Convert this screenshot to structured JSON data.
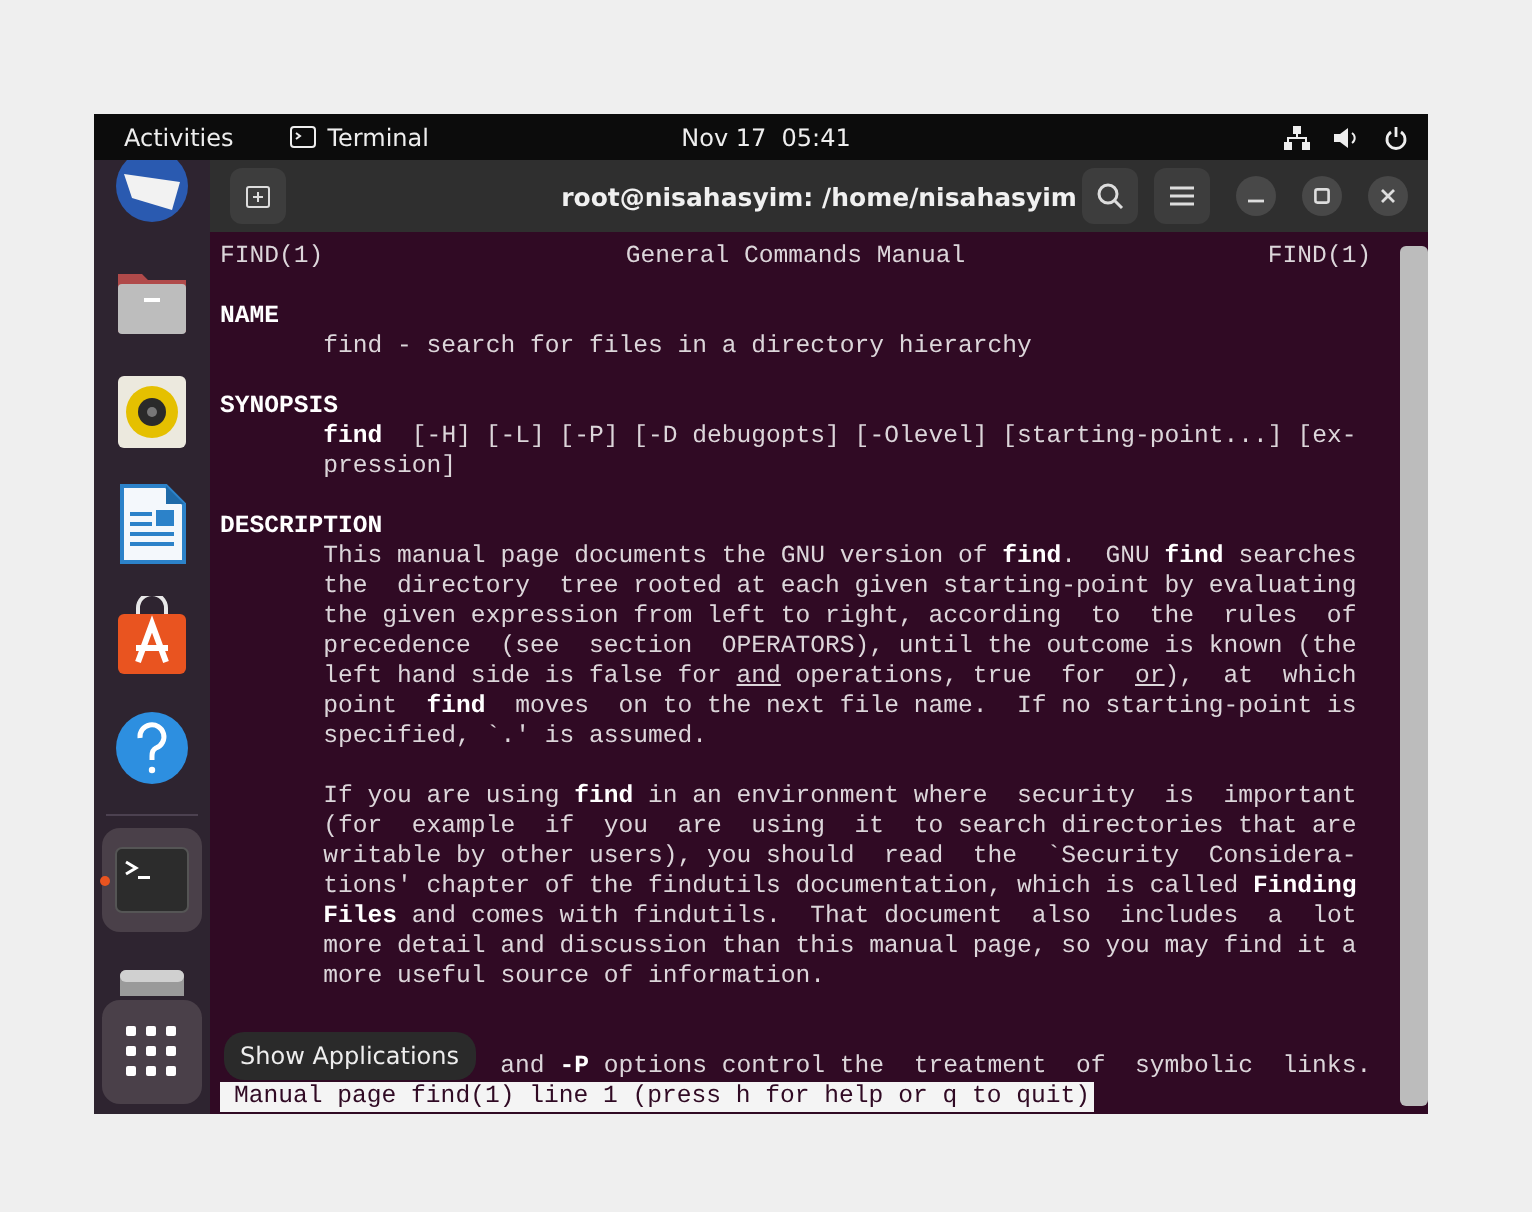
{
  "top_bar": {
    "activities": "Activities",
    "app_name": "Terminal",
    "clock": "Nov 17  05:41"
  },
  "dock": {
    "items": [
      {
        "kind": "mail",
        "selected": false,
        "running": false
      },
      {
        "kind": "files",
        "selected": false,
        "running": false
      },
      {
        "kind": "music",
        "selected": false,
        "running": false
      },
      {
        "kind": "writer",
        "selected": false,
        "running": false
      },
      {
        "kind": "store",
        "selected": false,
        "running": false
      },
      {
        "kind": "help",
        "selected": false,
        "running": false
      },
      {
        "kind": "separator"
      },
      {
        "kind": "terminal",
        "selected": true,
        "running": true
      },
      {
        "kind": "drive",
        "selected": false,
        "running": false
      }
    ],
    "show_apps": {
      "tooltip": "Show Applications",
      "hovered": true
    }
  },
  "window": {
    "title": "root@nisahasyim: /home/nisahasyim"
  },
  "man": {
    "header": {
      "left": "FIND(1)",
      "center": "General Commands Manual",
      "right": "FIND(1)"
    },
    "lines": [
      {
        "kind": "blank"
      },
      {
        "kind": "heading",
        "segments": [
          {
            "text": "NAME"
          }
        ]
      },
      {
        "kind": "body",
        "segments": [
          {
            "text": "find - search for files in a directory hierarchy"
          }
        ]
      },
      {
        "kind": "blank"
      },
      {
        "kind": "heading",
        "segments": [
          {
            "text": "SYNOPSIS"
          }
        ]
      },
      {
        "kind": "body",
        "segments": [
          {
            "text": "find",
            "kind": "bold"
          },
          {
            "text": "  [-H] [-L] [-P] [-D debugopts] [-Olevel] [starting-point...] [ex-"
          }
        ]
      },
      {
        "kind": "body",
        "segments": [
          {
            "text": "pression]"
          }
        ]
      },
      {
        "kind": "blank"
      },
      {
        "kind": "heading",
        "segments": [
          {
            "text": "DESCRIPTION"
          }
        ]
      },
      {
        "kind": "body",
        "segments": [
          {
            "text": "This manual page documents the GNU version of "
          },
          {
            "text": "find",
            "kind": "bold"
          },
          {
            "text": ".  GNU "
          },
          {
            "text": "find",
            "kind": "bold"
          },
          {
            "text": " searches"
          }
        ]
      },
      {
        "kind": "body",
        "segments": [
          {
            "text": "the  directory  tree rooted at each given starting-point by evaluating"
          }
        ]
      },
      {
        "kind": "body",
        "segments": [
          {
            "text": "the given expression from left to right, according  to  the  rules  of"
          }
        ]
      },
      {
        "kind": "body",
        "segments": [
          {
            "text": "precedence  (see  section  OPERATORS), until the outcome is known (the"
          }
        ]
      },
      {
        "kind": "body",
        "segments": [
          {
            "text": "left hand side is false for "
          },
          {
            "text": "and",
            "kind": "underlined"
          },
          {
            "text": " operations, true  for  "
          },
          {
            "text": "or",
            "kind": "underlined"
          },
          {
            "text": "),  at  which"
          }
        ]
      },
      {
        "kind": "body",
        "segments": [
          {
            "text": "point  "
          },
          {
            "text": "find",
            "kind": "bold"
          },
          {
            "text": "  moves  on to the next file name.  If no starting-point is"
          }
        ]
      },
      {
        "kind": "body",
        "segments": [
          {
            "text": "specified, `.' is assumed."
          }
        ]
      },
      {
        "kind": "blank"
      },
      {
        "kind": "body",
        "segments": [
          {
            "text": "If you are using "
          },
          {
            "text": "find",
            "kind": "bold"
          },
          {
            "text": " in an environment where  security  is  important"
          }
        ]
      },
      {
        "kind": "body",
        "segments": [
          {
            "text": "(for  example  if  you  are  using  it  to search directories that are"
          }
        ]
      },
      {
        "kind": "body",
        "segments": [
          {
            "text": "writable by other users), you should  read  the  `Security  Considera-"
          }
        ]
      },
      {
        "kind": "body",
        "segments": [
          {
            "text": "tions' chapter of the findutils documentation, which is called "
          },
          {
            "text": "Finding",
            "kind": "bold"
          }
        ]
      },
      {
        "kind": "body",
        "segments": [
          {
            "text": "Files",
            "kind": "bold"
          },
          {
            "text": " and comes with findutils.  That document  also  includes  a  lot"
          }
        ]
      },
      {
        "kind": "body",
        "segments": [
          {
            "text": "more detail and discussion than this manual page, so you may find it a"
          }
        ]
      },
      {
        "kind": "body",
        "segments": [
          {
            "text": "more useful source of information."
          }
        ]
      },
      {
        "kind": "blank"
      },
      {
        "kind": "blank"
      },
      {
        "kind": "covered",
        "segments": [
          {
            "text": "and "
          },
          {
            "text": "-P",
            "kind": "bold"
          },
          {
            "text": " options control the  treatment  of  symbolic  links."
          }
        ]
      }
    ],
    "status": "Manual page find(1) line 1 (press h for help or q to quit)"
  }
}
